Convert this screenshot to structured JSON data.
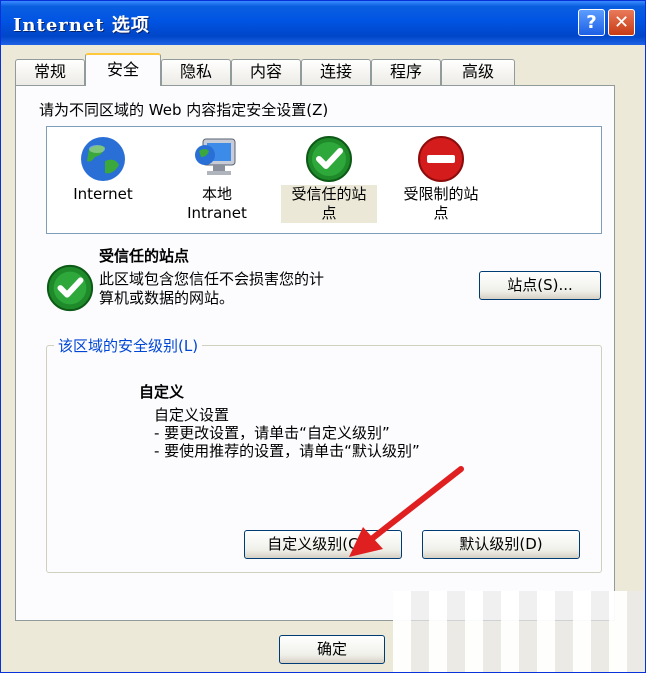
{
  "window": {
    "title": "Internet 选项",
    "help_label": "?",
    "close_label": "✕"
  },
  "tabs": [
    {
      "label": "常规"
    },
    {
      "label": "安全"
    },
    {
      "label": "隐私"
    },
    {
      "label": "内容"
    },
    {
      "label": "连接"
    },
    {
      "label": "程序"
    },
    {
      "label": "高级"
    }
  ],
  "security": {
    "zone_prompt": "请为不同区域的 Web 内容指定安全设置(Z)",
    "zones": [
      {
        "label": "Internet",
        "icon": "globe-icon"
      },
      {
        "label": "本地\nIntranet",
        "icon": "intranet-monitor-icon"
      },
      {
        "label": "受信任的站\n点",
        "icon": "trusted-checkmark-icon"
      },
      {
        "label": "受限制的站\n点",
        "icon": "restricted-no-entry-icon"
      }
    ],
    "selected_zone": {
      "title": "受信任的站点",
      "description_line1": "此区域包含您信任不会损害您的计",
      "description_line2": "算机或数据的网站。",
      "sites_button": "站点(S)..."
    },
    "level_group": {
      "title": "该区域的安全级别(L)",
      "level_name": "自定义",
      "detail1": "自定义设置",
      "detail2": "- 要更改设置，请单击“自定义级别”",
      "detail3": "- 要使用推荐的设置，请单击“默认级别”",
      "custom_level_button": "自定义级别(C)...",
      "default_level_button": "默认级别(D)"
    }
  },
  "footer": {
    "ok_button": "确定"
  },
  "colors": {
    "titlebar": "#0054e3",
    "dialog_bg": "#ece9d8",
    "panel_bg": "#fcfcfe",
    "group_title": "#0046d5",
    "annotation_arrow": "#e02020"
  }
}
